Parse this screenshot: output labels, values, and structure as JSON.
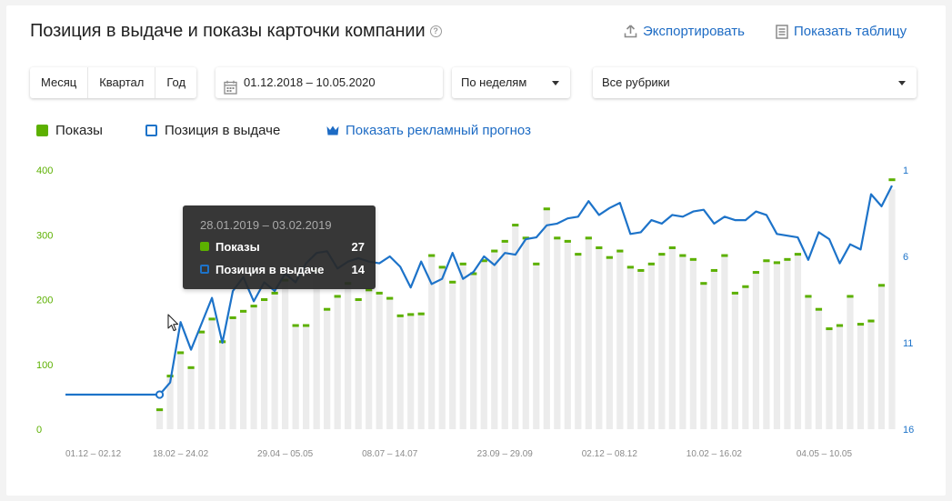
{
  "header": {
    "title": "Позиция в выдаче и показы карточки компании",
    "help_glyph": "?",
    "export_label": "Экспортировать",
    "show_table_label": "Показать таблицу"
  },
  "filters": {
    "periods": [
      "Месяц",
      "Квартал",
      "Год"
    ],
    "date_range": "01.12.2018 – 10.05.2020",
    "grouping": "По неделям",
    "rubric": "Все рубрики"
  },
  "legend": {
    "impressions": "Показы",
    "position": "Позиция в выдаче",
    "forecast_link": "Показать рекламный прогноз"
  },
  "colors": {
    "impressions": "#5cb000",
    "position": "#1d73c9",
    "link": "#1d6bc4",
    "bar": "#ececec"
  },
  "tooltip": {
    "date": "28.01.2019 – 03.02.2019",
    "impressions_label": "Показы",
    "impressions_value": "27",
    "position_label": "Позиция в выдаче",
    "position_value": "14"
  },
  "chart_data": {
    "type": "bar+line",
    "x_tick_labels": [
      "01.12 – 02.12",
      "18.02 – 24.02",
      "29.04 – 05.05",
      "08.07 – 14.07",
      "23.09 – 29.09",
      "02.12 – 08.12",
      "10.02 – 16.02",
      "04.05 – 10.05"
    ],
    "y_left": {
      "ticks": [
        "400",
        "300",
        "200",
        "100",
        "0"
      ],
      "range": [
        0,
        400
      ]
    },
    "y_right": {
      "ticks": [
        "1",
        "6",
        "11",
        "16"
      ],
      "range": [
        1,
        16
      ],
      "inverted": true
    },
    "series": [
      {
        "name": "Показы",
        "axis": "left",
        "values": [
          0,
          0,
          0,
          0,
          0,
          0,
          0,
          0,
          0,
          30,
          82,
          118,
          95,
          150,
          170,
          135,
          172,
          182,
          190,
          200,
          210,
          230,
          160,
          160,
          245,
          185,
          205,
          225,
          200,
          215,
          210,
          202,
          175,
          177,
          178,
          268,
          250,
          227,
          255,
          240,
          260,
          275,
          290,
          315,
          295,
          255,
          340,
          295,
          290,
          270,
          295,
          280,
          265,
          275,
          250,
          245,
          255,
          270,
          280,
          268,
          262,
          225,
          245,
          268,
          210,
          220,
          242,
          260,
          257,
          262,
          270,
          205,
          185,
          155,
          160,
          205,
          162,
          167,
          222,
          385
        ],
        "background_bar_values": [
          0,
          0,
          0,
          0,
          0,
          0,
          0,
          0,
          0,
          30,
          82,
          118,
          95,
          150,
          170,
          135,
          172,
          182,
          190,
          200,
          210,
          230,
          160,
          160,
          245,
          185,
          205,
          225,
          200,
          215,
          210,
          202,
          175,
          177,
          178,
          268,
          250,
          227,
          255,
          240,
          260,
          275,
          290,
          315,
          295,
          255,
          340,
          295,
          290,
          270,
          295,
          280,
          265,
          275,
          250,
          245,
          255,
          270,
          280,
          268,
          262,
          225,
          245,
          268,
          210,
          220,
          242,
          260,
          257,
          262,
          270,
          205,
          185,
          155,
          160,
          205,
          162,
          167,
          222,
          370
        ]
      },
      {
        "name": "Позиция в выдаче",
        "axis": "right",
        "values": [
          14,
          14,
          14,
          14,
          14,
          14,
          14,
          14,
          14,
          14,
          13.3,
          9.8,
          11.4,
          9.9,
          8.4,
          11.0,
          8.0,
          7.2,
          8.6,
          7.5,
          8.0,
          7.0,
          7.5,
          6.4,
          5.8,
          5.7,
          6.7,
          6.3,
          6.1,
          6.3,
          6.4,
          6.0,
          6.6,
          7.8,
          6.3,
          7.6,
          7.3,
          5.8,
          7.3,
          6.9,
          6.0,
          6.5,
          5.8,
          5.9,
          5.0,
          4.9,
          4.2,
          4.1,
          3.8,
          3.7,
          2.8,
          3.6,
          3.2,
          2.9,
          4.7,
          4.6,
          3.9,
          4.1,
          3.6,
          3.7,
          3.4,
          3.3,
          4.1,
          3.7,
          3.9,
          3.9,
          3.4,
          3.6,
          4.7,
          4.8,
          4.9,
          6.2,
          4.6,
          5.0,
          6.4,
          5.3,
          5.6,
          2.4,
          3.1,
          1.9
        ]
      }
    ]
  }
}
